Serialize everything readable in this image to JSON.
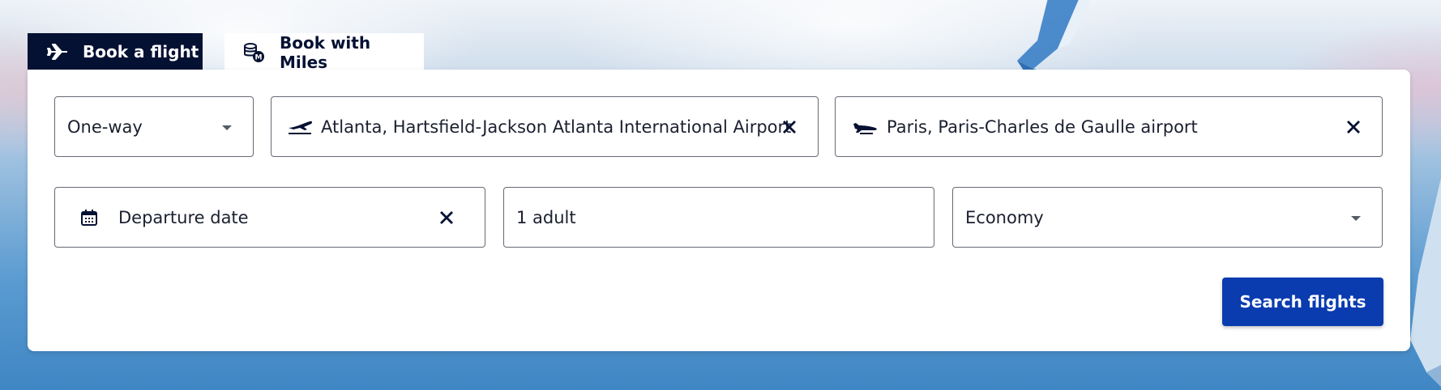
{
  "tabs": {
    "book_flight": {
      "label": "Book a flight",
      "icon": "plane-icon",
      "active": true
    },
    "book_miles": {
      "label": "Book with Miles",
      "icon": "miles-coins-icon",
      "active": false
    }
  },
  "search_form": {
    "trip_type": {
      "value": "One-way",
      "icon": "chevron-down-icon"
    },
    "origin": {
      "value": "Atlanta, Hartsfield-Jackson Atlanta International Airport",
      "icon": "plane-takeoff-icon"
    },
    "destination": {
      "value": "Paris, Paris-Charles de Gaulle airport",
      "icon": "plane-landing-icon"
    },
    "departure_date": {
      "placeholder": "Departure date",
      "icon": "calendar-icon"
    },
    "passengers": {
      "value": "1 adult"
    },
    "cabin_class": {
      "value": "Economy",
      "icon": "chevron-down-icon"
    },
    "search_button": {
      "label": "Search flights"
    }
  },
  "colors": {
    "navy": "#051133",
    "primary_button": "#0a3cb0",
    "field_border": "#666a73"
  }
}
